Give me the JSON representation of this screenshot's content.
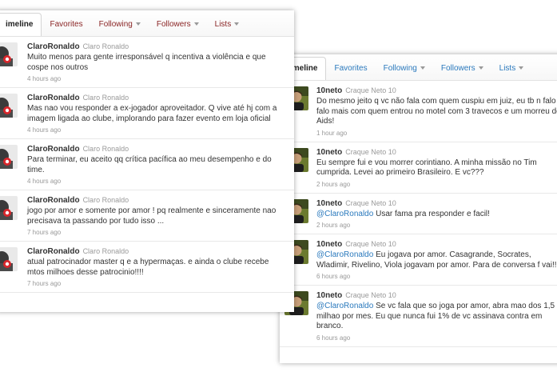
{
  "left": {
    "tabs": [
      {
        "label": "imeline",
        "active": true
      },
      {
        "label": "Favorites",
        "active": false
      },
      {
        "label": "Following",
        "active": false,
        "dropdown": true
      },
      {
        "label": "Followers",
        "active": false,
        "dropdown": true
      },
      {
        "label": "Lists",
        "active": false,
        "dropdown": true
      }
    ],
    "tweets": [
      {
        "user": "ClaroRonaldo",
        "name": "Claro Ronaldo",
        "text": "Muito menos para gente irresponsável q incentiva a violência e que cospe nos outros",
        "time": "4 hours ago"
      },
      {
        "user": "ClaroRonaldo",
        "name": "Claro Ronaldo",
        "text": "Mas nao vou responder a ex-jogador aproveitador. Q vive até hj com a imagem ligada ao clube, implorando para fazer evento em loja oficial",
        "time": "4 hours ago"
      },
      {
        "user": "ClaroRonaldo",
        "name": "Claro Ronaldo",
        "text": "Para terminar, eu aceito qq crítica pacífica ao meu desempenho e do time.",
        "time": "4 hours ago"
      },
      {
        "user": "ClaroRonaldo",
        "name": "Claro Ronaldo",
        "text": "jogo por amor e somente por amor ! pq realmente e sinceramente nao precisava ta passando por tudo isso ...",
        "time": "7 hours ago"
      },
      {
        "user": "ClaroRonaldo",
        "name": "Claro Ronaldo",
        "text": "atual patrocinador master q e a hypermaças. e ainda o clube recebe mtos milhoes desse patrocinio!!!!",
        "time": "7 hours ago"
      }
    ]
  },
  "right": {
    "tabs": [
      {
        "label": "imeline",
        "active": true
      },
      {
        "label": "Favorites",
        "active": false
      },
      {
        "label": "Following",
        "active": false,
        "dropdown": true
      },
      {
        "label": "Followers",
        "active": false,
        "dropdown": true
      },
      {
        "label": "Lists",
        "active": false,
        "dropdown": true
      }
    ],
    "tweets": [
      {
        "user": "10neto",
        "name": "Craque Neto 10",
        "mention": "",
        "text": "Do mesmo jeito q vc não fala com quem cuspiu em juiz, eu tb n falo falo mais com quem entrou no motel com 3 travecos e um morreu de Aids!",
        "time": "1 hour ago"
      },
      {
        "user": "10neto",
        "name": "Craque Neto 10",
        "mention": "",
        "text": "Eu sempre fui e vou morrer corintiano. A minha missão no Tim cumprida. Levei ao primeiro Brasileiro. E vc???",
        "time": "2 hours ago"
      },
      {
        "user": "10neto",
        "name": "Craque Neto 10",
        "mention": "@ClaroRonaldo",
        "text": " Usar fama pra responder e facil!",
        "time": "2 hours ago"
      },
      {
        "user": "10neto",
        "name": "Craque Neto 10",
        "mention": "@ClaroRonaldo",
        "text": " Eu jogava por amor. Casagrande, Socrates, Wladimir, Rivelino, Viola jogavam por amor. Para de conversa f vai!!!",
        "time": "6 hours ago"
      },
      {
        "user": "10neto",
        "name": "Craque Neto 10",
        "mention": "@ClaroRonaldo",
        "text": " Se vc fala que so joga por amor, abra mao dos 1,5 milhao por mes. Eu que nunca fui 1% de vc assinava contra em branco.",
        "time": "6 hours ago"
      }
    ]
  },
  "colors": {
    "left_link": "#8a2525",
    "right_link": "#2a79bd",
    "time": "#999999"
  }
}
